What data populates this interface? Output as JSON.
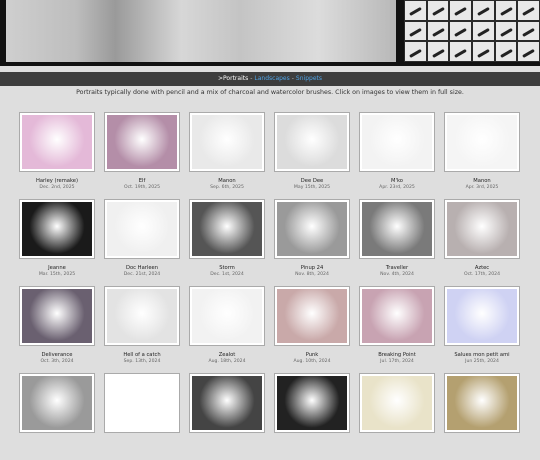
{
  "nav": {
    "current": ">Portraits",
    "links": [
      "Landscapes",
      "Snippets"
    ]
  },
  "intro": "Portraits typically done with pencil and a mix of charcoal and watercolor brushes. Click on images to view them in full size.",
  "portraits": [
    {
      "name": "Harley (remake)",
      "date": "Dec. 2nd, 2025",
      "fill": "#e4b9d8"
    },
    {
      "name": "Elf",
      "date": "Oct. 19th, 2025",
      "fill": "#b48ea8"
    },
    {
      "name": "Manon",
      "date": "Sep. 6th, 2025",
      "fill": "#e9e9e9"
    },
    {
      "name": "Dee Dee",
      "date": "May 15th, 2025",
      "fill": "#dcdcdc"
    },
    {
      "name": "M'ko",
      "date": "Apr. 23rd, 2025",
      "fill": "#f3f3f3"
    },
    {
      "name": "Manon",
      "date": "Apr. 3rd, 2025",
      "fill": "#f5f5f5"
    },
    {
      "name": "Jeanne",
      "date": "Mar. 15th, 2025",
      "fill": "#1a1a1a"
    },
    {
      "name": "Doc Harleen",
      "date": "Dec. 21st, 2024",
      "fill": "#f0f0f0"
    },
    {
      "name": "Storm",
      "date": "Dec. 1st, 2024",
      "fill": "#555555"
    },
    {
      "name": "Pinup 24",
      "date": "Nov. 8th, 2024",
      "fill": "#9a9a9a"
    },
    {
      "name": "Traveller",
      "date": "Nov. 4th, 2024",
      "fill": "#7a7a7a"
    },
    {
      "name": "Aztec",
      "date": "Oct. 17th, 2024",
      "fill": "#b8b0b0"
    },
    {
      "name": "Deliverance",
      "date": "Oct. 3th, 2024",
      "fill": "#6a6070"
    },
    {
      "name": "Hell of a catch",
      "date": "Sep. 13th, 2024",
      "fill": "#e3e3e3"
    },
    {
      "name": "Zealot",
      "date": "Aug. 18th, 2024",
      "fill": "#f2f2f2"
    },
    {
      "name": "Punk",
      "date": "Aug. 10th, 2024",
      "fill": "#c9a9a9"
    },
    {
      "name": "Breaking Point",
      "date": "Jul. 17th, 2024",
      "fill": "#c8a3b2"
    },
    {
      "name": "Salues mon petit ami",
      "date": "Jun 25th, 2024",
      "fill": "#cfd2f3"
    },
    {
      "name": "",
      "date": "",
      "fill": "#9a9a9a"
    },
    {
      "name": "",
      "date": "",
      "fill": "#ffffff"
    },
    {
      "name": "",
      "date": "",
      "fill": "#444444"
    },
    {
      "name": "",
      "date": "",
      "fill": "#222222"
    },
    {
      "name": "",
      "date": "",
      "fill": "#e9e3c9"
    },
    {
      "name": "",
      "date": "",
      "fill": "#b4a070"
    }
  ]
}
